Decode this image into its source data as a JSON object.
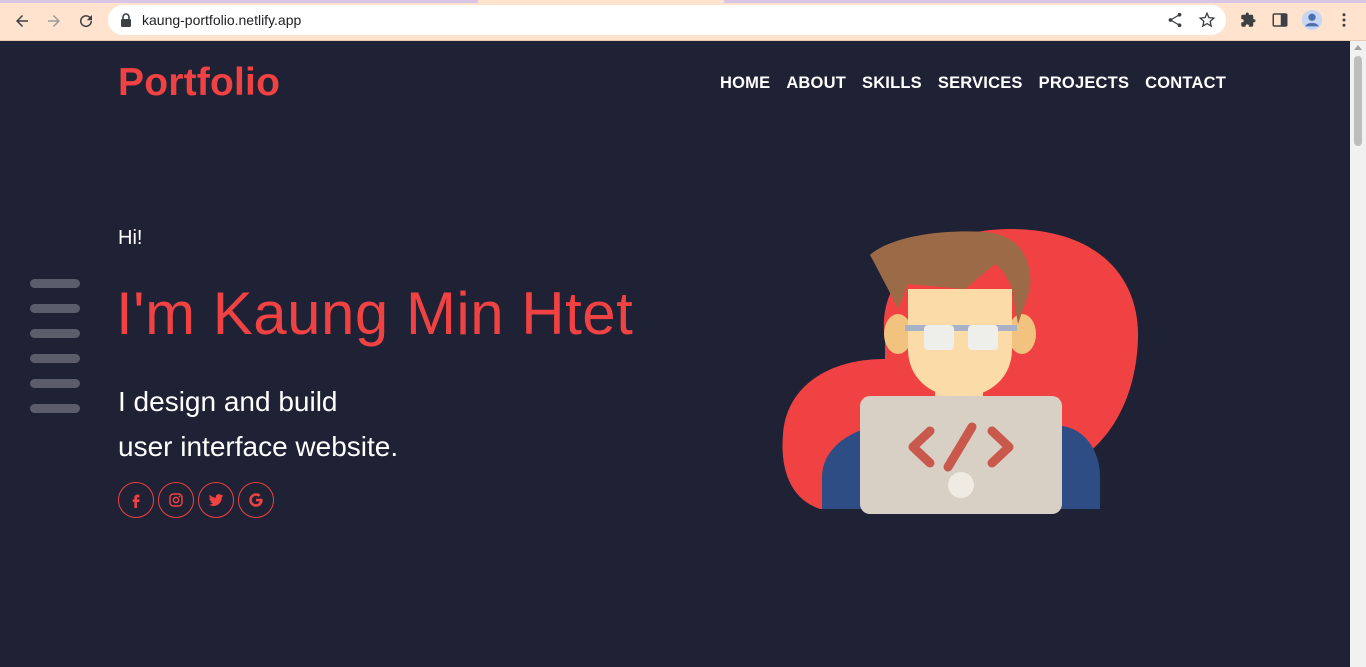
{
  "browser": {
    "url": "kaung-portfolio.netlify.app"
  },
  "nav": {
    "logo": "Portfolio",
    "items": [
      "HOME",
      "ABOUT",
      "SKILLS",
      "SERVICES",
      "PROJECTS",
      "CONTACT"
    ]
  },
  "hero": {
    "greeting": "Hi!",
    "name": "I'm Kaung Min Htet",
    "tagline_line1": "I design and build",
    "tagline_line2": "user interface website."
  },
  "socials": [
    "facebook-icon",
    "instagram-icon",
    "twitter-icon",
    "google-icon"
  ],
  "colors": {
    "accent": "#f04242",
    "background": "#1f2134",
    "text": "#ffffff"
  }
}
